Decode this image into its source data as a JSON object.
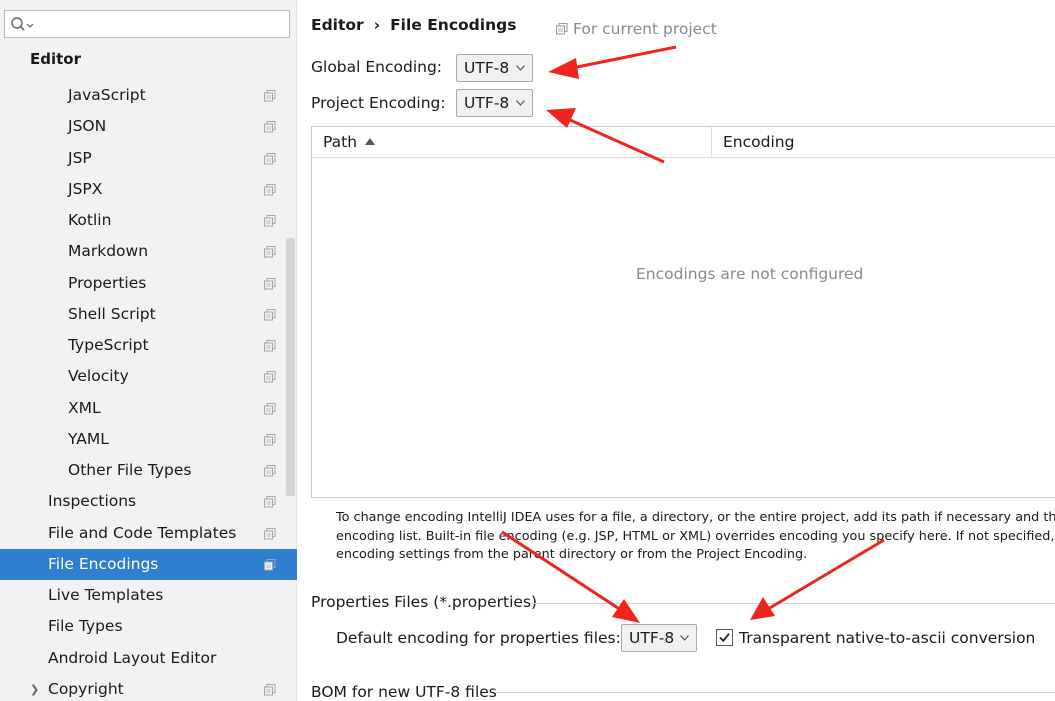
{
  "search": {
    "value": "",
    "placeholder": ""
  },
  "sidebar": {
    "section_title": "Editor",
    "subitems": [
      {
        "label": "JavaScript"
      },
      {
        "label": "JSON"
      },
      {
        "label": "JSP"
      },
      {
        "label": "JSPX"
      },
      {
        "label": "Kotlin"
      },
      {
        "label": "Markdown"
      },
      {
        "label": "Properties"
      },
      {
        "label": "Shell Script"
      },
      {
        "label": "TypeScript"
      },
      {
        "label": "Velocity"
      },
      {
        "label": "XML"
      },
      {
        "label": "YAML"
      },
      {
        "label": "Other File Types"
      }
    ],
    "items": [
      {
        "label": "Inspections"
      },
      {
        "label": "File and Code Templates"
      },
      {
        "label": "File Encodings"
      },
      {
        "label": "Live Templates"
      },
      {
        "label": "File Types"
      },
      {
        "label": "Android Layout Editor"
      },
      {
        "label": "Copyright"
      }
    ],
    "selected": "File Encodings"
  },
  "breadcrumb": {
    "parent": "Editor",
    "separator": "›",
    "current": "File Encodings"
  },
  "scope_hint": "For current project",
  "global_encoding": {
    "label": "Global Encoding:",
    "value": "UTF-8"
  },
  "project_encoding": {
    "label": "Project Encoding:",
    "value": "UTF-8"
  },
  "table": {
    "columns": [
      "Path",
      "Encoding"
    ],
    "sort_column": "Path",
    "empty_message": "Encodings are not configured"
  },
  "help_text": [
    "To change encoding IntelliJ IDEA uses for a file, a directory, or the entire project, add its path if necessary and then se",
    "encoding list. Built-in file encoding (e.g. JSP, HTML or XML) overrides encoding you specify here. If not specified, files",
    "encoding settings from the parent directory or from the Project Encoding."
  ],
  "properties_files": {
    "title": "Properties Files (*.properties)",
    "default_label": "Default encoding for properties files:",
    "default_value": "UTF-8",
    "checkbox_label": "Transparent native-to-ascii conversion",
    "checkbox_checked": true
  },
  "bom_title": "BOM for new UTF-8 files",
  "colors": {
    "selection": "#2f7fd0",
    "sidebar_bg": "#f2f2f2",
    "annotation_arrow": "#f0241c",
    "hint_text": "#8a8a8a"
  }
}
